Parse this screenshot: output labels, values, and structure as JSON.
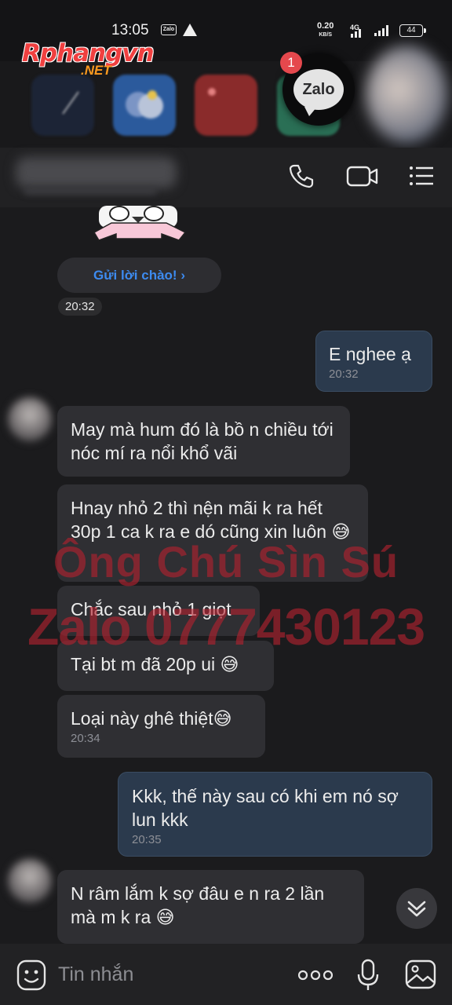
{
  "status_bar": {
    "time": "13:05",
    "app_icon_label": "Zalo",
    "net_speed": "0.20",
    "net_speed_unit": "KB/S",
    "network": "4G",
    "battery": "44"
  },
  "watermark_logo": {
    "name": "Rphangvn",
    "suffix": ".NET"
  },
  "floating_bubble": {
    "label": "Zalo",
    "badge": "1"
  },
  "header": {
    "icons": [
      "phone-icon",
      "video-call-icon",
      "menu-list-icon"
    ]
  },
  "chat": {
    "greet_button": "Gửi lời chào!  ›",
    "first_time": "20:32",
    "messages": [
      {
        "dir": "out",
        "text": "E  nghee ạ",
        "time": "20:32"
      },
      {
        "dir": "in",
        "text": "May mà hum đó là bồ n chiều tới nóc mí ra nổi khổ vãi",
        "time": ""
      },
      {
        "dir": "in",
        "text": "Hnay nhỏ 2 thì nện mãi k ra hết 30p 1 ca k ra e dó cũng xin luôn 😅",
        "time": ""
      },
      {
        "dir": "in",
        "text": "Chắc sau nhỏ 1 giọt",
        "time": ""
      },
      {
        "dir": "in",
        "text": "Tại bt m đã 20p ui 😅",
        "time": ""
      },
      {
        "dir": "in",
        "text": "Loại này ghê thiệt😅",
        "time": "20:34"
      },
      {
        "dir": "out",
        "text": "Kkk, thế này sau có khi em nó sợ lun kkk",
        "time": "20:35"
      },
      {
        "dir": "in",
        "text": "N râm lắm k sợ đâu e n ra 2 lần mà m k ra 😅",
        "time": ""
      }
    ]
  },
  "overlay_watermark": {
    "line1": "Ông Chú Sìn Sú",
    "line2": "Zalo 0777430123"
  },
  "input_bar": {
    "placeholder": "Tin nhắn"
  },
  "colors": {
    "background": "#1b1b1d",
    "incoming_bubble": "#2f2f33",
    "outgoing_bubble": "#2b3a4d",
    "accent_link": "#3d8bf0",
    "watermark": "#b4222e",
    "badge": "#e5484d"
  }
}
